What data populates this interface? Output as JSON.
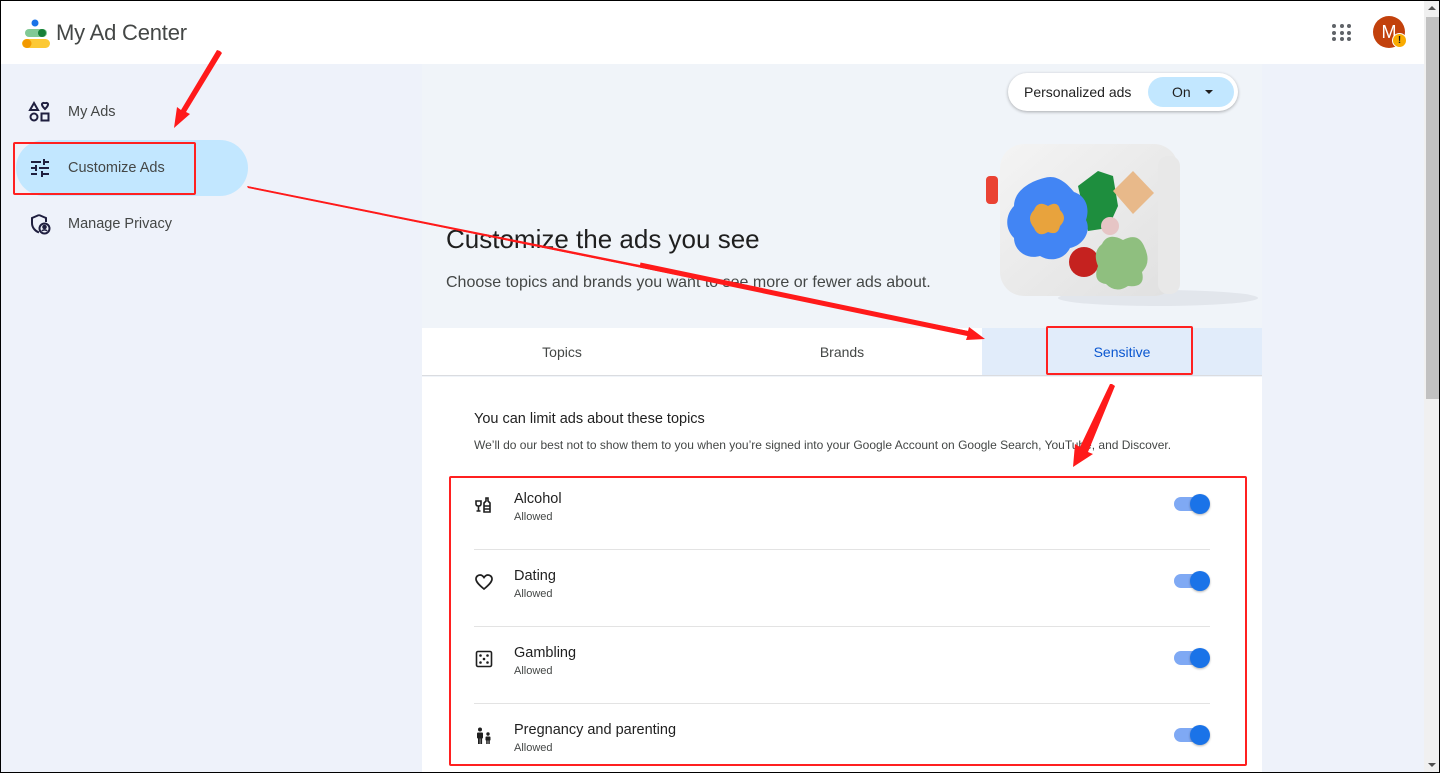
{
  "header": {
    "app_title": "My Ad Center",
    "apps_icon": "google-apps-grid-icon",
    "avatar_letter": "M",
    "avatar_badge": "!"
  },
  "sidebar": {
    "items": [
      {
        "label": "My Ads",
        "icon": "shapes-icon",
        "active": false
      },
      {
        "label": "Customize Ads",
        "icon": "tune-sliders-icon",
        "active": true
      },
      {
        "label": "Manage Privacy",
        "icon": "shield-person-icon",
        "active": false
      }
    ]
  },
  "personalized_ads": {
    "label": "Personalized ads",
    "value": "On"
  },
  "hero": {
    "title": "Customize the ads you see",
    "subtitle": "Choose topics and brands you want to see more or fewer ads about."
  },
  "tabs": [
    {
      "label": "Topics",
      "active": false
    },
    {
      "label": "Brands",
      "active": false
    },
    {
      "label": "Sensitive",
      "active": true
    }
  ],
  "sensitive": {
    "title": "You can limit ads about these topics",
    "description": "We’ll do our best not to show them to you when you’re signed into your Google Account on Google Search, YouTube, and Discover.",
    "topics": [
      {
        "name": "Alcohol",
        "status": "Allowed",
        "icon": "alcohol-bottle-icon",
        "enabled": true
      },
      {
        "name": "Dating",
        "status": "Allowed",
        "icon": "heart-icon",
        "enabled": true
      },
      {
        "name": "Gambling",
        "status": "Allowed",
        "icon": "dice-icon",
        "enabled": true
      },
      {
        "name": "Pregnancy and parenting",
        "status": "Allowed",
        "icon": "parent-child-icon",
        "enabled": true
      }
    ]
  },
  "colors": {
    "accent": "#0b57d0",
    "active_nav": "#c2e7ff",
    "toggle_on": "#1a73e8",
    "annotation": "#ff2020"
  }
}
